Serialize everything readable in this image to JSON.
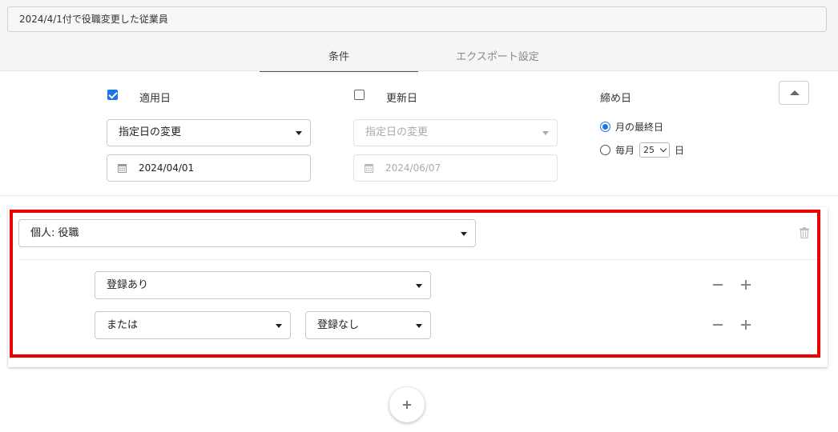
{
  "header": {
    "title_value": "2024/4/1付で役職変更した従業員"
  },
  "tabs": [
    {
      "label": "条件",
      "active": true
    },
    {
      "label": "エクスポート設定",
      "active": false
    }
  ],
  "date_filters": {
    "applied_date": {
      "label": "適用日",
      "checked": true,
      "select_value": "指定日の変更",
      "date_value": "2024/04/01"
    },
    "updated_date": {
      "label": "更新日",
      "checked": false,
      "select_value": "指定日の変更",
      "date_value": "2024/06/07"
    },
    "closing_date": {
      "label": "締め日",
      "option_month_end": "月の最終日",
      "option_monthly_prefix": "毎月",
      "option_monthly_day": "25",
      "option_monthly_suffix": "日",
      "selected": "month_end"
    }
  },
  "condition": {
    "field_select": "個人: 役職",
    "rows": [
      {
        "value_select": "登録あり"
      },
      {
        "operator_select": "または",
        "value_select": "登録なし"
      }
    ]
  },
  "colors": {
    "accent": "#1e73e8",
    "highlight": "#ee0000"
  },
  "icons": {
    "calendar": "calendar-icon",
    "trash": "trash-icon",
    "collapse": "chevron-up-icon",
    "add": "plus-icon",
    "remove": "minus-icon"
  }
}
